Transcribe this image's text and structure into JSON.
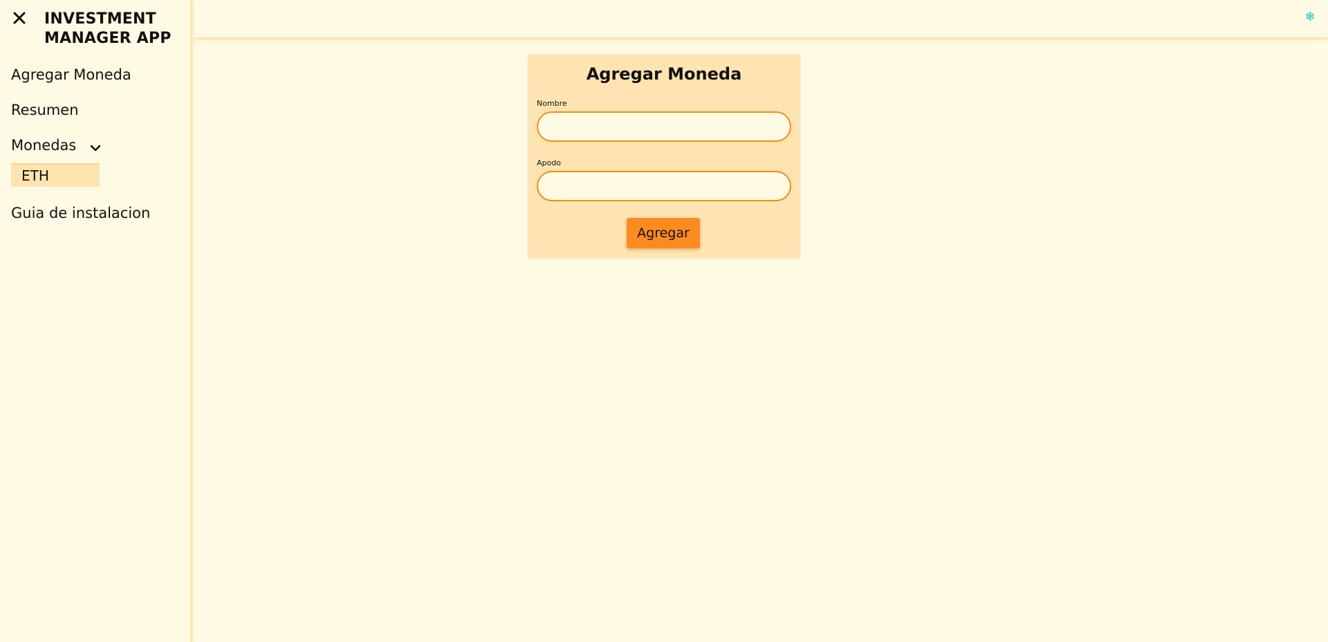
{
  "app": {
    "title": "INVESTMENT MANAGER APP"
  },
  "sidebar": {
    "close_icon": "close-icon",
    "items": [
      {
        "label": "Agregar Moneda"
      },
      {
        "label": "Resumen"
      },
      {
        "label": "Monedas",
        "icon": "chevron-down-icon",
        "expanded": true
      },
      {
        "label": "Guia de instalacion"
      }
    ],
    "monedas_children": [
      {
        "label": "ETH"
      }
    ]
  },
  "topbar": {
    "icon": "snowflake-icon",
    "icon_glyph": "❄"
  },
  "form": {
    "title": "Agregar Moneda",
    "fields": [
      {
        "label": "Nombre",
        "value": "",
        "placeholder": ""
      },
      {
        "label": "Apodo",
        "value": "",
        "placeholder": ""
      }
    ],
    "submit_label": "Agregar"
  },
  "colors": {
    "background": "#fffae3",
    "panel": "#ffe4b2",
    "accent": "#fd8b1f",
    "input_border": "#f28b16",
    "icon": "#19c2d6"
  }
}
